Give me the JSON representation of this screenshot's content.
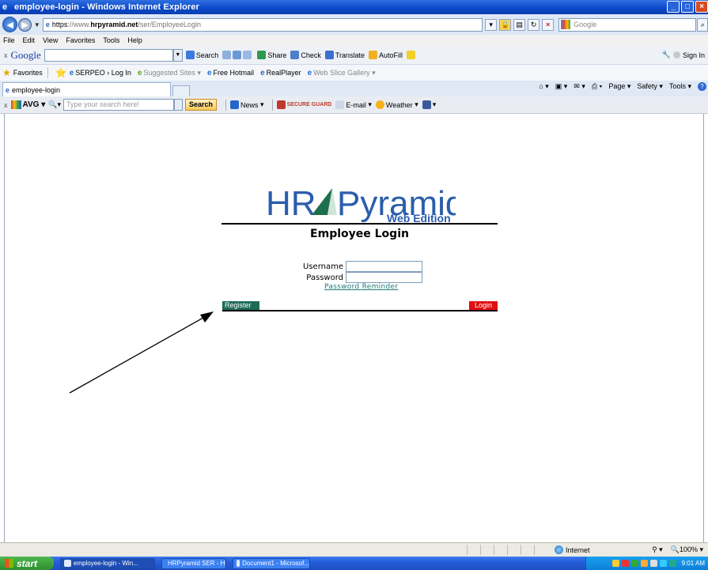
{
  "window": {
    "title": "employee-login - Windows Internet Explorer"
  },
  "address_bar": {
    "url_prefix": "https",
    "url_scheme": "://www.",
    "url_domain": "hrpyramid.net",
    "url_path": "/ser/EmployeeLogin",
    "search_placeholder": "Google"
  },
  "menu": [
    "File",
    "Edit",
    "View",
    "Favorites",
    "Tools",
    "Help"
  ],
  "google_toolbar": {
    "logo": "Google",
    "items": [
      "Search",
      "Share",
      "Check",
      "Translate",
      "AutoFill"
    ],
    "sign_in": "Sign In"
  },
  "favorites_bar": {
    "label": "Favorites",
    "items": [
      {
        "label": "SERPEO › Log In",
        "dim": false
      },
      {
        "label": "Suggested Sites",
        "dim": true
      },
      {
        "label": "Free Hotmail",
        "dim": false
      },
      {
        "label": "RealPlayer",
        "dim": false
      },
      {
        "label": "Web Slice Gallery",
        "dim": true
      }
    ]
  },
  "tab": {
    "label": "employee-login"
  },
  "command_bar": [
    "Page",
    "Safety",
    "Tools"
  ],
  "avg_toolbar": {
    "logo": "AVG",
    "search_placeholder": "Type your search here!",
    "search_button": "Search",
    "items": [
      "News",
      "SECURE GUARD",
      "E-mail",
      "Weather"
    ]
  },
  "page": {
    "logo_hr": "HR",
    "logo_pyramid": "Pyramid",
    "logo_edition": "Web Edition",
    "heading": "Employee Login",
    "username_label": "Username",
    "password_label": "Password",
    "username_value": "",
    "password_value": "",
    "password_reminder": "Password Reminder",
    "register_label": "Register",
    "login_label": "Login"
  },
  "status_bar": {
    "zone": "Internet",
    "zoom": "100%"
  },
  "taskbar": {
    "start_label": "start",
    "tasks": [
      {
        "label": "employee-login - Win...",
        "active": true
      },
      {
        "label": "HRPyramid SER - HR...",
        "active": false
      },
      {
        "label": "Document1 - Microsof...",
        "active": false
      }
    ],
    "clock": "9:01 AM"
  }
}
